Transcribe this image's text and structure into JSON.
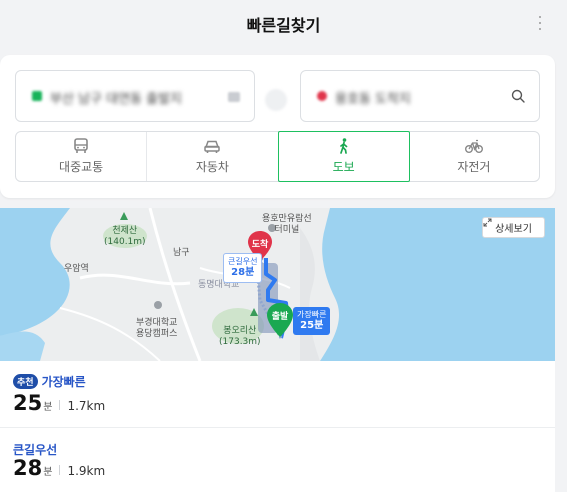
{
  "header": {
    "title": "빠른길찾기"
  },
  "search": {
    "start_text": "부산 남구 대연동 출발지",
    "end_text": "용호동 도착지"
  },
  "modes": [
    {
      "label": "대중교통",
      "icon": "bus-icon",
      "active": false
    },
    {
      "label": "자동차",
      "icon": "car-icon",
      "active": false
    },
    {
      "label": "도보",
      "icon": "walk-icon",
      "active": true
    },
    {
      "label": "자전거",
      "icon": "bicycle-icon",
      "active": false
    }
  ],
  "map": {
    "detail_button": "상세보기",
    "labels": {
      "cheonjesan": "천제산",
      "cheonjesan_height": "(140.1m)",
      "yongho_terminal": "용호만유람선\n터미널",
      "nam_gu": "남구",
      "uam_station": "우암역",
      "dongmyeong_univ": "동명대학교",
      "pukyong_univ": "부경대학교\n용당캠퍼스",
      "bongorisan": "봉오리산",
      "bongorisan_height": "(173.3m)"
    },
    "markers": {
      "end": "도착",
      "start": "출발"
    },
    "bubbles": {
      "alt_name": "큰길우선",
      "alt_time": "28분",
      "fast_name": "가장빠른",
      "fast_time": "25분"
    },
    "colors": {
      "route_main": "#2f7af0",
      "water": "#9cd2f0",
      "marker_start": "#1aa851",
      "marker_end": "#e0344a"
    }
  },
  "routes": [
    {
      "badge": "추천",
      "name": "가장빠른",
      "minutes": "25",
      "unit": "분",
      "distance": "1.7km"
    },
    {
      "badge": "",
      "name": "큰길우선",
      "minutes": "28",
      "unit": "분",
      "distance": "1.9km"
    }
  ]
}
